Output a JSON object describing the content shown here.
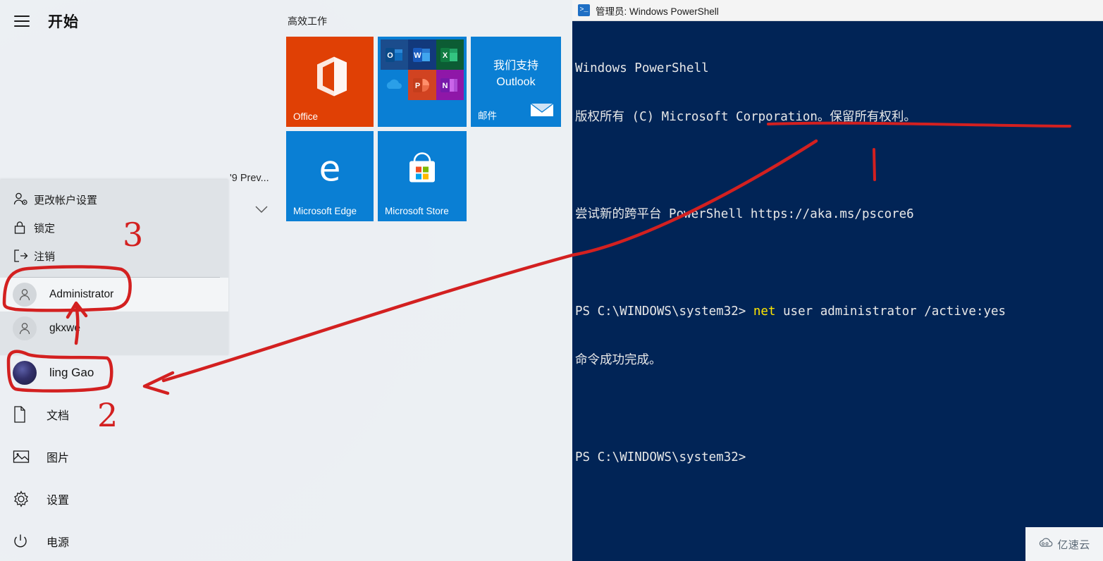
{
  "start": {
    "menu_icon": "hamburger-icon",
    "title": "开始",
    "app_list_entry": "'9 Prev...",
    "expand_chevron": "chevron-down-icon"
  },
  "tiles": {
    "group_title": "高效工作",
    "items": [
      {
        "name": "Office",
        "label": "Office",
        "color": "#e04005",
        "icon": "office-icon"
      },
      {
        "name": "office-apps",
        "label": "",
        "color": "#0a7fd4",
        "icon": "office-apps-grid-icon",
        "apps": [
          "Outlook",
          "Word",
          "Excel",
          "OneDrive",
          "PowerPoint",
          "OneNote"
        ]
      },
      {
        "name": "mail",
        "label": "邮件",
        "color": "#0a7fd4",
        "icon": "envelope-icon",
        "promo_line1": "我们支持",
        "promo_line2": "Outlook"
      },
      {
        "name": "edge",
        "label": "Microsoft Edge",
        "color": "#0a7fd4",
        "icon": "edge-icon"
      },
      {
        "name": "store",
        "label": "Microsoft Store",
        "color": "#0a7fd4",
        "icon": "store-icon"
      }
    ]
  },
  "account_flyout": {
    "menu": [
      {
        "label": "更改帐户设置",
        "icon": "user-settings-icon"
      },
      {
        "label": "锁定",
        "icon": "lock-icon"
      },
      {
        "label": "注销",
        "icon": "sign-out-icon"
      }
    ],
    "users": [
      {
        "name": "Administrator",
        "selected": true,
        "icon": "user-icon"
      },
      {
        "name": "gkxwe",
        "selected": false,
        "icon": "user-icon"
      }
    ]
  },
  "sidebar": {
    "current_user": "ling Gao",
    "items": [
      {
        "label": "文档",
        "icon": "document-icon"
      },
      {
        "label": "图片",
        "icon": "picture-icon"
      },
      {
        "label": "设置",
        "icon": "gear-icon"
      },
      {
        "label": "电源",
        "icon": "power-icon"
      }
    ]
  },
  "powershell": {
    "title": "管理员: Windows PowerShell",
    "title_icon": "powershell-icon",
    "lines": [
      "Windows PowerShell",
      "版权所有 (C) Microsoft Corporation。保留所有权利。",
      "",
      "尝试新的跨平台 PowerShell https://aka.ms/pscore6",
      "",
      "命令成功完成。",
      "",
      ""
    ],
    "prompt": "PS C:\\WINDOWS\\system32>",
    "command_keyword": "net",
    "command_rest": " user administrator /active:yes",
    "result": "命令成功完成。"
  },
  "annotations": {
    "color": "#d32020",
    "markers": [
      {
        "label": "1",
        "target": "Administrator"
      },
      {
        "label": "2",
        "target": "ling Gao"
      },
      {
        "label": "3",
        "target": "account-menu"
      }
    ]
  },
  "watermark": {
    "text": "亿速云",
    "icon": "cloud-icon"
  }
}
